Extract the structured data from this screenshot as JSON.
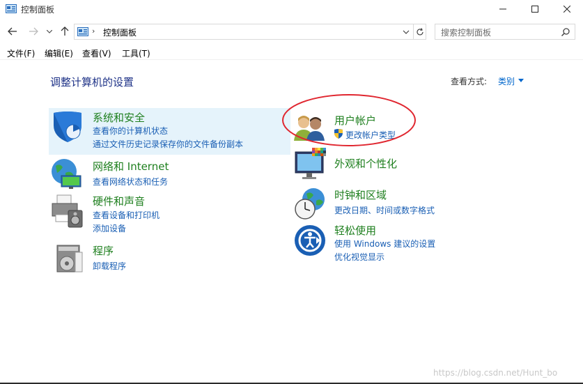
{
  "window": {
    "title": "控制面板"
  },
  "address": {
    "path": "控制面板",
    "separator": "›"
  },
  "search": {
    "placeholder": "搜索控制面板"
  },
  "menu": [
    "文件(F)",
    "编辑(E)",
    "查看(V)",
    "工具(T)"
  ],
  "main": {
    "title": "调整计算机的设置",
    "view_by_label": "查看方式:",
    "view_by_value": "类别"
  },
  "categories_left": [
    {
      "title": "系统和安全",
      "links": [
        "查看你的计算机状态",
        "通过文件历史记录保存你的文件备份副本"
      ],
      "icon": "shield-icon"
    },
    {
      "title": "网络和 Internet",
      "links": [
        "查看网络状态和任务"
      ],
      "icon": "network-globe-icon"
    },
    {
      "title": "硬件和声音",
      "links": [
        "查看设备和打印机",
        "添加设备"
      ],
      "icon": "printer-icon"
    },
    {
      "title": "程序",
      "links": [
        "卸载程序"
      ],
      "icon": "programs-icon"
    }
  ],
  "categories_right": [
    {
      "title": "用户帐户",
      "links": [
        "更改帐户类型"
      ],
      "icon": "users-icon"
    },
    {
      "title": "外观和个性化",
      "links": [],
      "icon": "monitor-icon"
    },
    {
      "title": "时钟和区域",
      "links": [
        "更改日期、时间或数字格式"
      ],
      "icon": "clock-globe-icon"
    },
    {
      "title": "轻松使用",
      "links": [
        "使用 Windows 建议的设置",
        "优化视觉显示"
      ],
      "icon": "ease-of-access-icon"
    }
  ],
  "watermark": "https://blog.csdn.net/Hunt_bo",
  "colors": {
    "category_title": "#1e7f1e",
    "link": "#1a5fb4",
    "page_title": "#1e3287",
    "highlight": "#e5f3fb",
    "annotation": "#e0262f"
  }
}
